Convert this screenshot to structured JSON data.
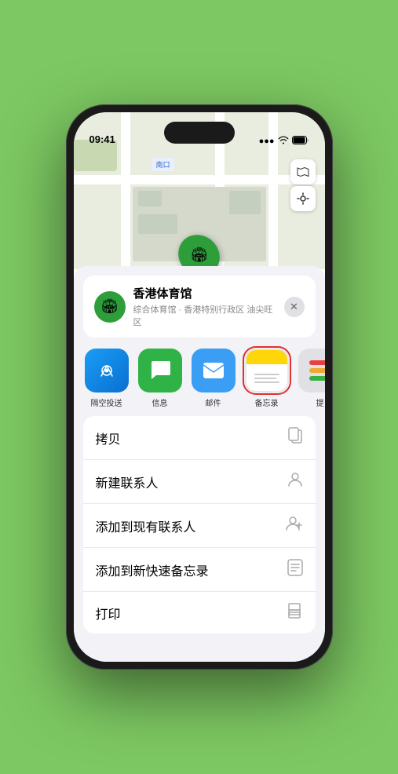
{
  "status": {
    "time": "09:41",
    "signal": "●●●",
    "wifi": "wifi",
    "battery": "battery"
  },
  "map": {
    "label": "南口",
    "pin_label": "香港体育馆"
  },
  "location_card": {
    "title": "香港体育馆",
    "subtitle": "综合体育馆 · 香港特别行政区 油尖旺区",
    "close_label": "×"
  },
  "share_items": [
    {
      "id": "airdrop",
      "label": "隔空投送"
    },
    {
      "id": "messages",
      "label": "信息"
    },
    {
      "id": "mail",
      "label": "邮件"
    },
    {
      "id": "notes",
      "label": "备忘录"
    },
    {
      "id": "more",
      "label": "提"
    }
  ],
  "actions": [
    {
      "label": "拷贝",
      "icon": "copy"
    },
    {
      "label": "新建联系人",
      "icon": "person"
    },
    {
      "label": "添加到现有联系人",
      "icon": "person-add"
    },
    {
      "label": "添加到新快速备忘录",
      "icon": "note"
    },
    {
      "label": "打印",
      "icon": "print"
    }
  ]
}
